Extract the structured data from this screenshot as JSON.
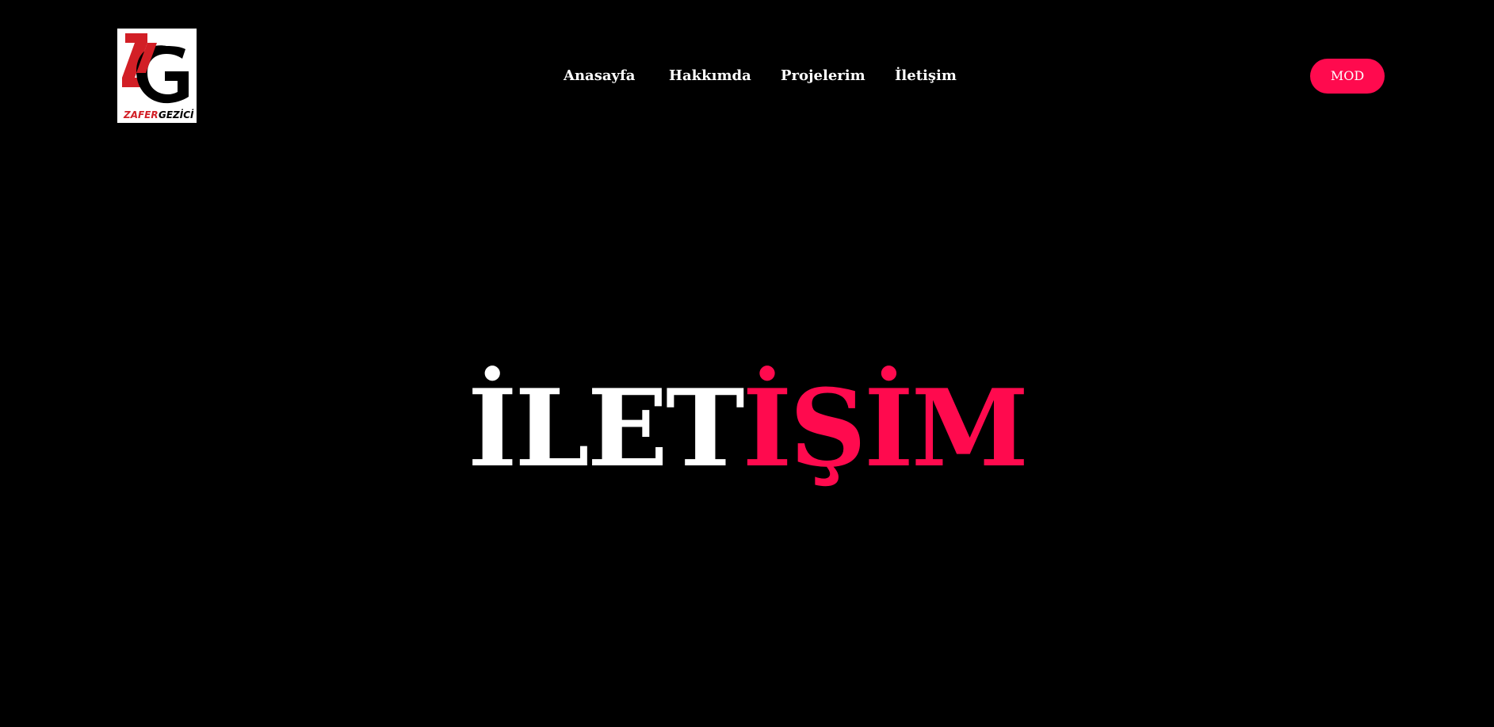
{
  "logo": {
    "text_primary": "ZAFER",
    "text_secondary": "GEZİCİ",
    "monogram": "ZG",
    "colors": {
      "red": "#d21f26",
      "black": "#000000",
      "background": "#ffffff"
    }
  },
  "nav": {
    "items": [
      {
        "label": "Anasayfa"
      },
      {
        "label": "Hakkımda"
      },
      {
        "label": "Projelerim"
      },
      {
        "label": "İletişim"
      }
    ]
  },
  "mode_button": {
    "label": "MOD"
  },
  "hero": {
    "title_part1": "İLET",
    "title_part2": "İŞİM"
  },
  "theme": {
    "background": "#000000",
    "text": "#ffffff",
    "accent": "#ff0a4e"
  }
}
